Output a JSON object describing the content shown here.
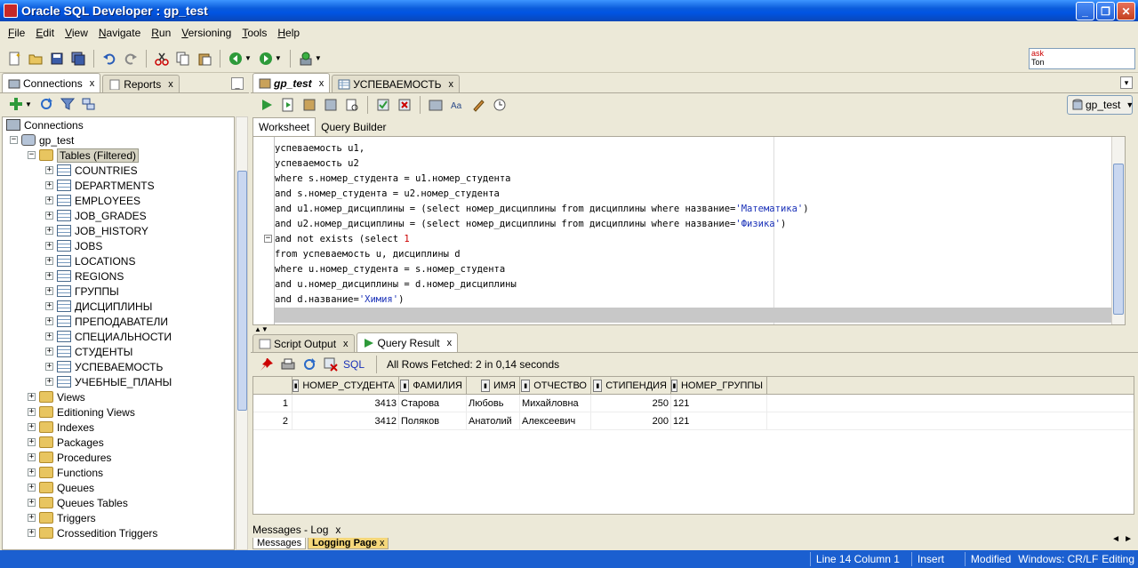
{
  "window": {
    "title": "Oracle SQL Developer : gp_test"
  },
  "menu": [
    "File",
    "Edit",
    "View",
    "Navigate",
    "Run",
    "Versioning",
    "Tools",
    "Help"
  ],
  "memory": {
    "line1": "ask",
    "line2": "Ton"
  },
  "left_panel": {
    "tabs": [
      {
        "label": "Connections"
      },
      {
        "label": "Reports"
      }
    ],
    "tree": {
      "root": "Connections",
      "connection": "gp_test",
      "tables_folder": "Tables (Filtered)",
      "tables": [
        "COUNTRIES",
        "DEPARTMENTS",
        "EMPLOYEES",
        "JOB_GRADES",
        "JOB_HISTORY",
        "JOBS",
        "LOCATIONS",
        "REGIONS",
        "ГРУППЫ",
        "ДИСЦИПЛИНЫ",
        "ПРЕПОДАВАТЕЛИ",
        "СПЕЦИАЛЬНОСТИ",
        "СТУДЕНТЫ",
        "УСПЕВАЕМОСТЬ",
        "УЧЕБНЫЕ_ПЛАНЫ"
      ],
      "folders": [
        "Views",
        "Editioning Views",
        "Indexes",
        "Packages",
        "Procedures",
        "Functions",
        "Queues",
        "Queues Tables",
        "Triggers",
        "Crossedition Triggers"
      ]
    }
  },
  "editor": {
    "doc_tabs": [
      {
        "label": "gp_test"
      },
      {
        "label": "УСПЕВАЕМОСТЬ"
      }
    ],
    "connection_select": "gp_test",
    "worksheet_tabs": [
      "Worksheet",
      "Query Builder"
    ],
    "code": [
      {
        "parts": [
          {
            "t": "успеваемость u1,"
          }
        ]
      },
      {
        "parts": [
          {
            "t": "успеваемость u2"
          }
        ]
      },
      {
        "parts": [
          {
            "t": "where s.номер_студента = u1.номер_студента"
          }
        ]
      },
      {
        "parts": [
          {
            "t": "and s.номер_студента = u2.номер_студента"
          }
        ]
      },
      {
        "parts": [
          {
            "t": "and u1.номер_дисциплины = (select номер_дисциплины from дисциплины where название="
          },
          {
            "t": "'Математика'",
            "c": "str"
          },
          {
            "t": ")"
          }
        ]
      },
      {
        "parts": [
          {
            "t": "and u2.номер_дисциплины = (select номер_дисциплины from дисциплины where название="
          },
          {
            "t": "'Физика'",
            "c": "str"
          },
          {
            "t": ")"
          }
        ]
      },
      {
        "parts": [
          {
            "t": "and not exists (select "
          },
          {
            "t": "1",
            "c": "num"
          }
        ]
      },
      {
        "parts": [
          {
            "t": "from успеваемость u, дисциплины d"
          }
        ]
      },
      {
        "parts": [
          {
            "t": "where u.номер_студента = s.номер_студента"
          }
        ]
      },
      {
        "parts": [
          {
            "t": "and u.номер_дисциплины = d.номер_дисциплины"
          }
        ]
      },
      {
        "parts": [
          {
            "t": "and d.название="
          },
          {
            "t": "'Химия'",
            "c": "str"
          },
          {
            "t": ")"
          }
        ]
      }
    ]
  },
  "results": {
    "tabs": [
      {
        "label": "Script Output"
      },
      {
        "label": "Query Result"
      }
    ],
    "sql_label": "SQL",
    "fetch_status": "All Rows Fetched: 2 in 0,14 seconds",
    "columns": [
      "НОМЕР_СТУДЕНТА",
      "ФАМИЛИЯ",
      "ИМЯ",
      "ОТЧЕСТВО",
      "СТИПЕНДИЯ",
      "НОМЕР_ГРУППЫ"
    ],
    "rows": [
      [
        "1",
        "3413",
        "Старова",
        "Любовь",
        "Михайловна",
        "250",
        "121"
      ],
      [
        "2",
        "3412",
        "Поляков",
        "Анатолий",
        "Алексеевич",
        "200",
        "121"
      ]
    ]
  },
  "messages": {
    "title": "Messages - Log",
    "tabs": [
      "Messages",
      "Logging Page"
    ]
  },
  "status": {
    "position": "Line 14 Column 1",
    "mode": "Insert",
    "modified": "Modified",
    "encoding": "Windows: CR/LF",
    "state": "Editing"
  }
}
